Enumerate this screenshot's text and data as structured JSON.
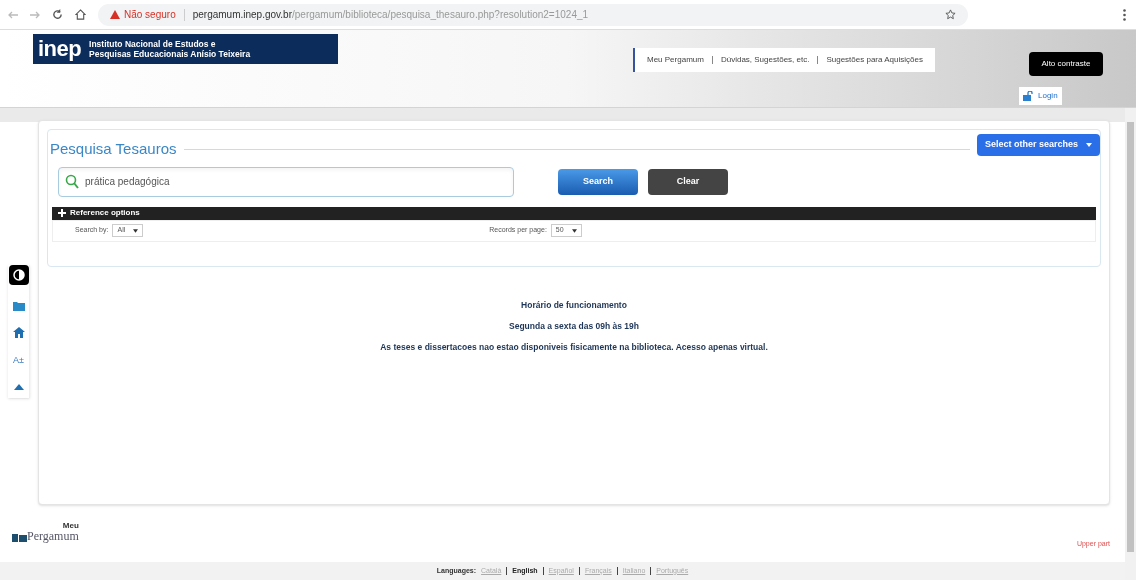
{
  "browser": {
    "security": "Não seguro",
    "url_host": "pergamum.inep.gov.br",
    "url_path": "/pergamum/biblioteca/pesquisa_thesauro.php?resolution2=1024_1"
  },
  "header": {
    "logo": "inep",
    "institute": [
      "Instituto Nacional de Estudos e",
      "Pesquisas Educacionais Anísio Teixeira"
    ],
    "links": [
      "Meu Pergamum",
      "Dúvidas, Sugestões, etc.",
      "Sugestões para Aquisições"
    ],
    "contrast_button": "Alto contraste",
    "login": "Login"
  },
  "search": {
    "title": "Pesquisa Tesauros",
    "other_searches": "Select other searches",
    "value": "prática pedagógica",
    "search_button": "Search",
    "clear_button": "Clear",
    "options_title": "Reference options",
    "search_by_label": "Search by:",
    "search_by": "All",
    "records_label": "Records per page:",
    "records": "50"
  },
  "side_tools": [
    {
      "kind": "contrast"
    },
    {
      "kind": "folder"
    },
    {
      "kind": "home"
    },
    {
      "kind": "font",
      "label": "A±"
    },
    {
      "kind": "up"
    }
  ],
  "notice": [
    "Horário de funcionamento",
    "Segunda a sexta das 09h às 19h",
    "As teses e dissertacoes nao estao disponiveis fisicamente na biblioteca. Acesso apenas virtual."
  ],
  "footer": {
    "logo_small": "Meu",
    "logo": "Pergamum",
    "upper_part": "Upper part",
    "languages_label": "Languages:",
    "languages": [
      {
        "label": "Català",
        "selected": false
      },
      {
        "label": "English",
        "selected": true
      },
      {
        "label": "Español",
        "selected": false
      },
      {
        "label": "Français",
        "selected": false
      },
      {
        "label": "Italiano",
        "selected": false
      },
      {
        "label": "Português",
        "selected": false
      }
    ]
  }
}
